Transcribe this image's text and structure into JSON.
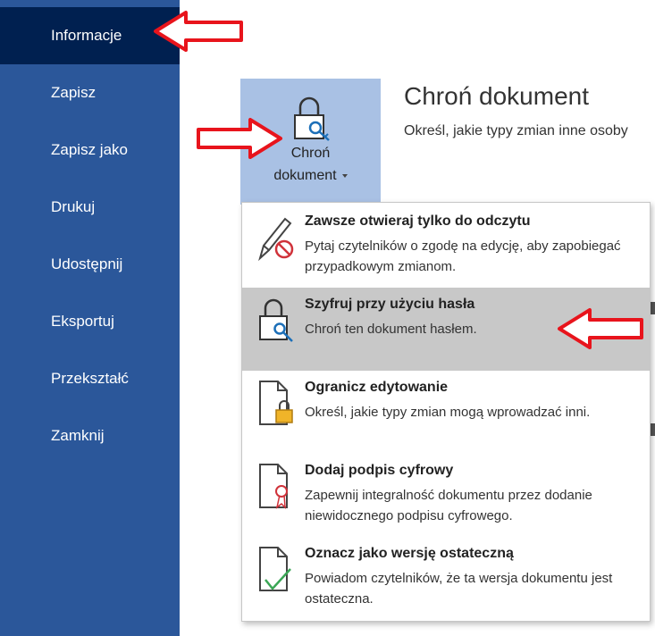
{
  "sidebar": {
    "items": [
      {
        "label": "Informacje",
        "active": true
      },
      {
        "label": "Zapisz"
      },
      {
        "label": "Zapisz jako"
      },
      {
        "label": "Drukuj"
      },
      {
        "label": "Udostępnij"
      },
      {
        "label": "Eksportuj"
      },
      {
        "label": "Przekształć"
      },
      {
        "label": "Zamknij"
      }
    ]
  },
  "protect_button": {
    "line1": "Chroń",
    "line2": "dokument",
    "icon": "lock-key-icon"
  },
  "section": {
    "title": "Chroń dokument",
    "description": "Określ, jakie typy zmian inne osoby"
  },
  "menu": {
    "items": [
      {
        "title": "Zawsze otwieraj tylko do odczytu",
        "description": "Pytaj czytelników o zgodę na edycję, aby zapobiegać przypadkowym zmianom.",
        "icon": "pencil-no-icon"
      },
      {
        "title": "Szyfruj przy użyciu hasła",
        "description": "Chroń ten dokument hasłem.",
        "icon": "lock-key-icon",
        "highlighted": true
      },
      {
        "title": "Ogranicz edytowanie",
        "description": "Określ, jakie typy zmian mogą wprowadzać inni.",
        "icon": "document-lock-icon"
      },
      {
        "title": "Dodaj podpis cyfrowy",
        "description": "Zapewnij integralność dokumentu przez dodanie niewidocznego podpisu cyfrowego.",
        "icon": "document-ribbon-icon"
      },
      {
        "title": "Oznacz jako wersję ostateczną",
        "description": "Powiadom czytelników, że ta wersja dokumentu jest ostateczna.",
        "icon": "document-check-icon"
      }
    ]
  },
  "colors": {
    "sidebar": "#2b579a",
    "sidebar_active": "#002050",
    "button_bg": "#a9c1e4",
    "highlight": "#c8c8c8",
    "annotation_arrow": "#e8141c"
  }
}
